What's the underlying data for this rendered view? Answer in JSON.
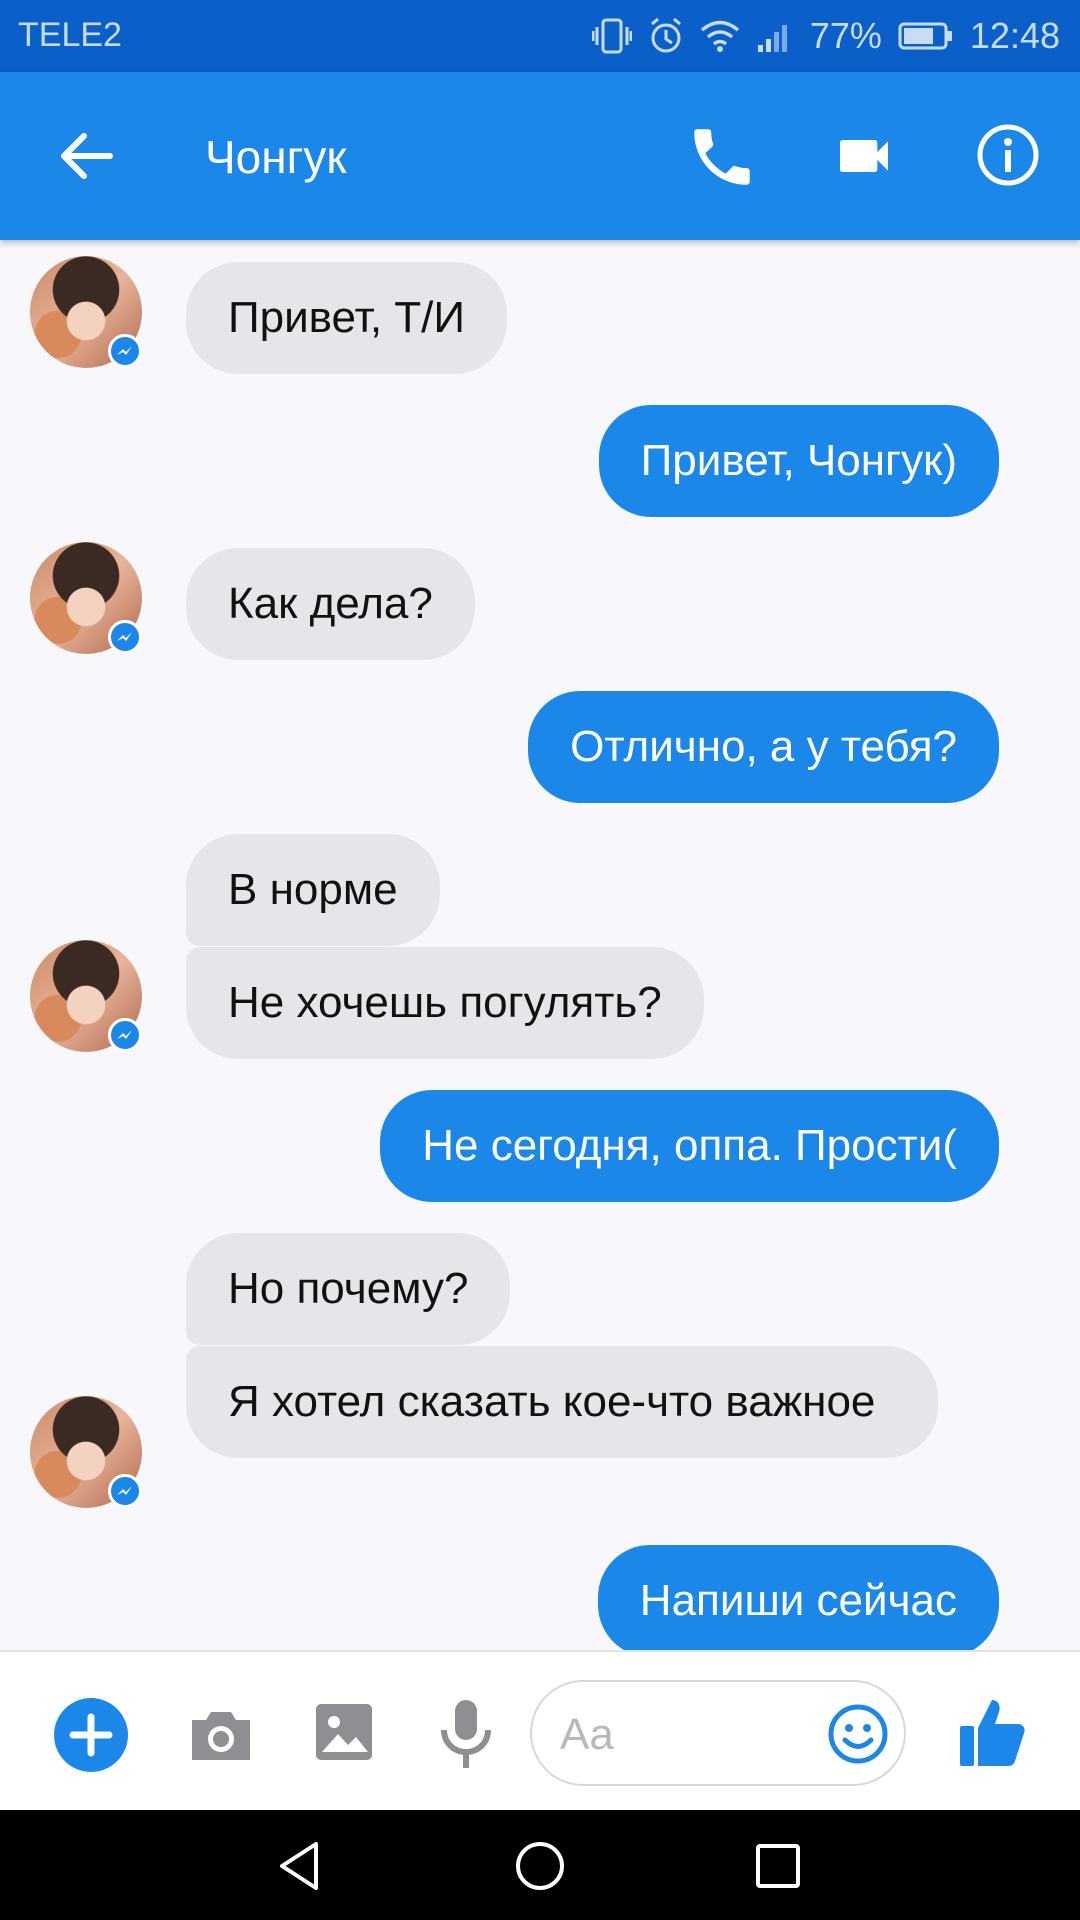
{
  "status_bar": {
    "carrier": "TELE2",
    "battery": "77%",
    "time": "12:48"
  },
  "header": {
    "contact_name": "Чонгук",
    "icons": [
      "back-arrow-icon",
      "phone-icon",
      "video-camera-icon",
      "info-icon"
    ]
  },
  "messages": [
    {
      "from": "contact",
      "text": "Привет, Т/И"
    },
    {
      "from": "me",
      "text": "Привет, Чонгук)"
    },
    {
      "from": "contact",
      "text": "Как дела?"
    },
    {
      "from": "me",
      "text": "Отлично, а у тебя?"
    },
    {
      "from": "contact",
      "text": "В норме"
    },
    {
      "from": "contact",
      "text": "Не хочешь погулять?"
    },
    {
      "from": "me",
      "text": "Не сегодня, оппа.  Прости("
    },
    {
      "from": "contact",
      "text": "Но почему?"
    },
    {
      "from": "contact",
      "text": "Я хотел сказать кое-что важное"
    },
    {
      "from": "me",
      "text": "Напиши сейчас"
    }
  ],
  "composer": {
    "placeholder": "Aa",
    "icons": [
      "plus-icon",
      "camera-icon",
      "gallery-icon",
      "microphone-icon",
      "emoji-icon",
      "thumbs-up-icon"
    ]
  },
  "colors": {
    "status_bar": "#0a5fc9",
    "app_bar": "#1b87e8",
    "incoming_bubble": "#e6e5ea",
    "outgoing_bubble": "#1b87e8",
    "background": "#f8f7fb"
  }
}
